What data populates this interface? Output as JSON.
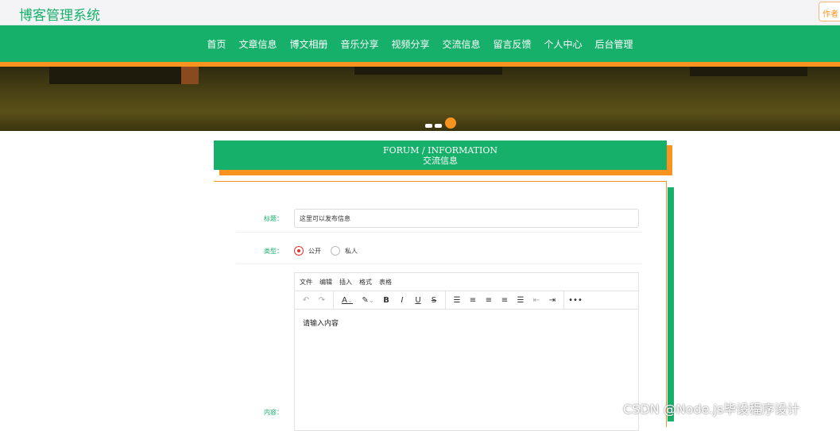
{
  "header": {
    "title": "博客管理系统",
    "author_button": "作者"
  },
  "nav": [
    "首页",
    "文章信息",
    "博文相册",
    "音乐分享",
    "视频分享",
    "交流信息",
    "留言反馈",
    "个人中心",
    "后台管理"
  ],
  "banner": {
    "slides": 3,
    "active": 3
  },
  "section": {
    "en": "FORUM / INFORMATION",
    "cn": "交流信息"
  },
  "form": {
    "title_label": "标题：",
    "title_value": "这里可以发布信息",
    "type_label": "类型：",
    "type_options": [
      "公开",
      "私人"
    ],
    "type_selected": "公开",
    "content_label": "内容：",
    "editor": {
      "menu": [
        "文件",
        "编辑",
        "插入",
        "格式",
        "表格"
      ],
      "placeholder": "请输入内容"
    }
  },
  "watermark": "CSDN @Node.js毕设程序设计",
  "colors": {
    "primary": "#16b06b",
    "accent": "#f7931e"
  }
}
